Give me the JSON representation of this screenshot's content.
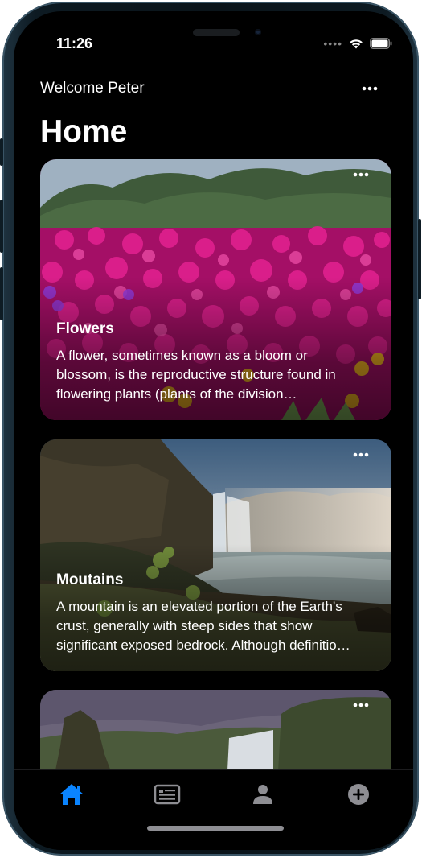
{
  "status_bar": {
    "time": "11:26"
  },
  "header": {
    "welcome": "Welcome Peter",
    "title": "Home"
  },
  "cards": [
    {
      "title": "Flowers",
      "description": "A flower, sometimes known as a bloom or blossom, is the reproductive structure found in flowering plants (plants of the division Magnoliophyta, also called angiosperms).",
      "image": "magenta-flower-field"
    },
    {
      "title": "Moutains",
      "description": "A mountain is an elevated portion of the Earth's crust, generally with steep sides that show significant exposed bedrock. Although definitions vary.",
      "image": "waterfall-cliffs"
    },
    {
      "title": "",
      "description": "",
      "image": "waterfall-valley"
    }
  ],
  "tab_bar": {
    "items": [
      {
        "icon": "home-icon",
        "active": true
      },
      {
        "icon": "newspaper-icon",
        "active": false
      },
      {
        "icon": "person-icon",
        "active": false
      },
      {
        "icon": "plus-circle-icon",
        "active": false
      }
    ]
  },
  "colors": {
    "accent": "#0a84ff",
    "inactive": "#8e8e93",
    "background": "#000000"
  }
}
